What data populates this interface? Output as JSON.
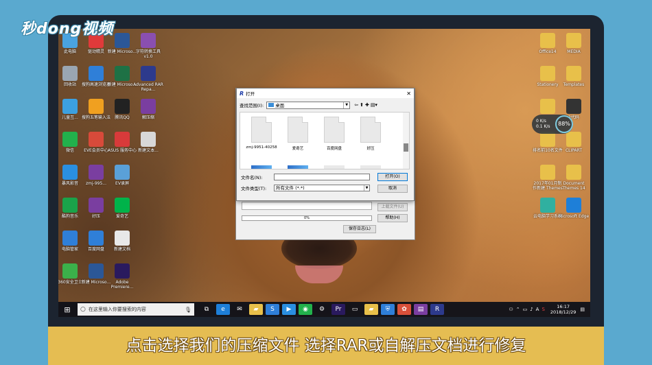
{
  "watermark": "秒dong视频",
  "desktop_left": [
    {
      "label": "此电脑",
      "icon": "computer-icon",
      "color": "#4aa3df"
    },
    {
      "label": "驱动精灵",
      "icon": "driver-icon",
      "color": "#e03a3a"
    },
    {
      "label": "新建 Microso...",
      "icon": "word-icon",
      "color": "#2b5797"
    },
    {
      "label": "字符转换工具v1.0",
      "icon": "rar-icon",
      "color": "#8a4fb0"
    },
    {
      "label": "回收站",
      "icon": "recycle-bin-icon",
      "color": "#9aa6b2"
    },
    {
      "label": "搜狗高速浏览器",
      "icon": "sogou-browser-icon",
      "color": "#2f7fd8"
    },
    {
      "label": "新建 Microso...",
      "icon": "excel-icon",
      "color": "#1e7145"
    },
    {
      "label": "Advanced RAR Repa...",
      "icon": "rar-repair-icon",
      "color": "#2d3a8c"
    },
    {
      "label": "儿童互...",
      "icon": "kids-app-icon",
      "color": "#3ca0e0"
    },
    {
      "label": "搜狗五笔输入法",
      "icon": "sogou-wubi-icon",
      "color": "#f0a020"
    },
    {
      "label": "腾讯QQ",
      "icon": "qq-icon",
      "color": "#222222"
    },
    {
      "label": "解压缩",
      "icon": "winrar-icon",
      "color": "#7a3ea0"
    },
    {
      "label": "微信",
      "icon": "wechat-icon",
      "color": "#22b14c"
    },
    {
      "label": "EVE会员中心",
      "icon": "pdf-icon",
      "color": "#d84a3a"
    },
    {
      "label": "ASUS 服务中心",
      "icon": "home-icon",
      "color": "#d83a3a"
    },
    {
      "label": "新建文本...",
      "icon": "text-file-icon",
      "color": "#d8d8d8"
    },
    {
      "label": "暴风影音",
      "icon": "player-icon",
      "color": "#2a8fe0"
    },
    {
      "label": "zmj-995...",
      "icon": "rar-file-icon",
      "color": "#7a3ea0"
    },
    {
      "label": "EV录屏",
      "icon": "ev-recorder-icon",
      "color": "#5aa0d8"
    },
    {
      "label": "",
      "icon": "blank-icon",
      "color": "rgba(0,0,0,0)"
    },
    {
      "label": "酷狗音乐",
      "icon": "kugou-icon",
      "color": "#1aa34a"
    },
    {
      "label": "好压",
      "icon": "haozip-icon",
      "color": "#7a3ea0"
    },
    {
      "label": "爱奇艺",
      "icon": "iqiyi-icon",
      "color": "#00b34a"
    },
    {
      "label": "",
      "icon": "blank-icon",
      "color": "rgba(0,0,0,0)"
    },
    {
      "label": "电脑管家",
      "icon": "pc-manager-icon",
      "color": "#2f7fd8"
    },
    {
      "label": "百度网盘",
      "icon": "baidu-netdisk-icon",
      "color": "#2f7fd8"
    },
    {
      "label": "新建文档",
      "icon": "doc-icon",
      "color": "#e8e8e8"
    },
    {
      "label": "",
      "icon": "blank-icon",
      "color": "rgba(0,0,0,0)"
    },
    {
      "label": "360安全卫士",
      "icon": "security-icon",
      "color": "#3bb14a"
    },
    {
      "label": "新建 Microso...",
      "icon": "word-doc-icon",
      "color": "#2b5797"
    },
    {
      "label": "Adobe Premiere...",
      "icon": "premiere-icon",
      "color": "#2a1a5e"
    }
  ],
  "desktop_right": [
    {
      "label": "Office14",
      "icon": "folder-icon",
      "color": "#e8c04a"
    },
    {
      "label": "MEDIA",
      "icon": "folder-icon",
      "color": "#e8c04a"
    },
    {
      "label": "Stationery",
      "icon": "folder-icon",
      "color": "#e8c04a"
    },
    {
      "label": "Templates",
      "icon": "folder-icon",
      "color": "#e8c04a"
    },
    {
      "label": "",
      "icon": "folder-icon",
      "color": "#e8c04a"
    },
    {
      "label": "3代码",
      "icon": "dark-folder-icon",
      "color": "#333333"
    },
    {
      "label": "排名前10名文件",
      "icon": "folder-icon",
      "color": "#e8c04a"
    },
    {
      "label": "CLIPART",
      "icon": "folder-icon",
      "color": "#e8c04a"
    },
    {
      "label": "2017年01月制作新建 Themes",
      "icon": "folder-icon",
      "color": "#e8c04a"
    },
    {
      "label": "Document Themes 14",
      "icon": "folder-icon",
      "color": "#e8c04a"
    },
    {
      "label": "云电脑学习系统",
      "icon": "cloud-study-icon",
      "color": "#30b0a0"
    },
    {
      "label": "Microsoft Edge",
      "icon": "edge-icon",
      "color": "#1e7fd8"
    }
  ],
  "perf": {
    "up": "0",
    "up_unit": "K/s",
    "down": "0.1",
    "down_unit": "K/s",
    "percent": "88%"
  },
  "taskbar": {
    "search_placeholder": "在这里输入你要搜索的内容",
    "apps": [
      {
        "icon": "task-view-icon",
        "glyph": "⧉",
        "color": "rgba(0,0,0,0)"
      },
      {
        "icon": "edge-icon",
        "glyph": "e",
        "color": "#1e7fd8"
      },
      {
        "icon": "mail-icon",
        "glyph": "✉",
        "color": "rgba(0,0,0,0)"
      },
      {
        "icon": "file-explorer-icon",
        "glyph": "▰",
        "color": "#e8c04a"
      },
      {
        "icon": "sogou-browser-icon",
        "glyph": "S",
        "color": "#2f7fd8"
      },
      {
        "icon": "player-icon",
        "glyph": "▶",
        "color": "#2a8fe0"
      },
      {
        "icon": "wechat-icon",
        "glyph": "◉",
        "color": "#22b14c"
      },
      {
        "icon": "gear-icon",
        "glyph": "⚙",
        "color": "rgba(0,0,0,0)"
      },
      {
        "icon": "premiere-icon",
        "glyph": "Pr",
        "color": "#2a1a5e"
      },
      {
        "icon": "tablet-icon",
        "glyph": "▭",
        "color": "rgba(0,0,0,0)"
      },
      {
        "icon": "folder-icon",
        "glyph": "▰",
        "color": "#e8c04a"
      },
      {
        "icon": "shield-icon",
        "glyph": "⛨",
        "color": "#2f7fd8"
      },
      {
        "icon": "flower-icon",
        "glyph": "✿",
        "color": "#d8503a"
      },
      {
        "icon": "winrar-icon",
        "glyph": "▤",
        "color": "#7a3ea0"
      },
      {
        "icon": "rar-repair-icon",
        "glyph": "R",
        "color": "#2d3a8c"
      }
    ],
    "tray": {
      "ime": "A",
      "time": "16:17",
      "date": "2018/12/29"
    }
  },
  "dialog": {
    "title": "打开",
    "look_in_label": "查找范围(I):",
    "look_in_value": "桌面",
    "files": [
      {
        "name": "zmj-9951-40258"
      },
      {
        "name": "爱奇艺"
      },
      {
        "name": "百度网盘"
      },
      {
        "name": "好压"
      }
    ],
    "filename_label": "文件名(N):",
    "filename_value": "",
    "filetype_label": "文件类型(T):",
    "filetype_value": "所有文件 (*.*)",
    "open_button": "打开(O)",
    "cancel_button": "取消"
  },
  "background_dialog": {
    "upload_button": "上载文件(U)",
    "help_button": "帮助(H)",
    "save_log_button": "保存日志(L)",
    "progress_text": "0%"
  },
  "subtitle": "点击选择我们的压缩文件 选择RAR或自解压文档进行修复"
}
